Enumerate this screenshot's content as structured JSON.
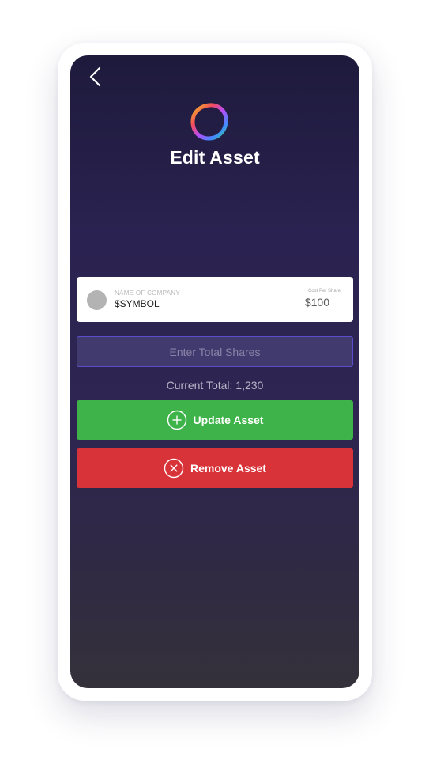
{
  "header": {
    "title": "Edit Asset",
    "back_icon": "chevron-left-icon",
    "logo_icon": "ring-logo-icon"
  },
  "asset_card": {
    "company_label": "NAME OF COMPANY",
    "symbol": "$SYMBOL",
    "cost_label": "Cost Per Share",
    "cost_value": "$100"
  },
  "shares_input": {
    "value": "",
    "placeholder": "Enter Total Shares"
  },
  "current_total": "Current Total: 1,230",
  "actions": {
    "update_label": "Update Asset",
    "update_icon": "plus-circle-icon",
    "remove_label": "Remove Asset",
    "remove_icon": "x-circle-icon"
  },
  "colors": {
    "update": "#3db349",
    "remove": "#d9333a",
    "input_border": "#5b4fc9",
    "background_top": "#1e1a3c",
    "background_bottom": "#35313a"
  }
}
